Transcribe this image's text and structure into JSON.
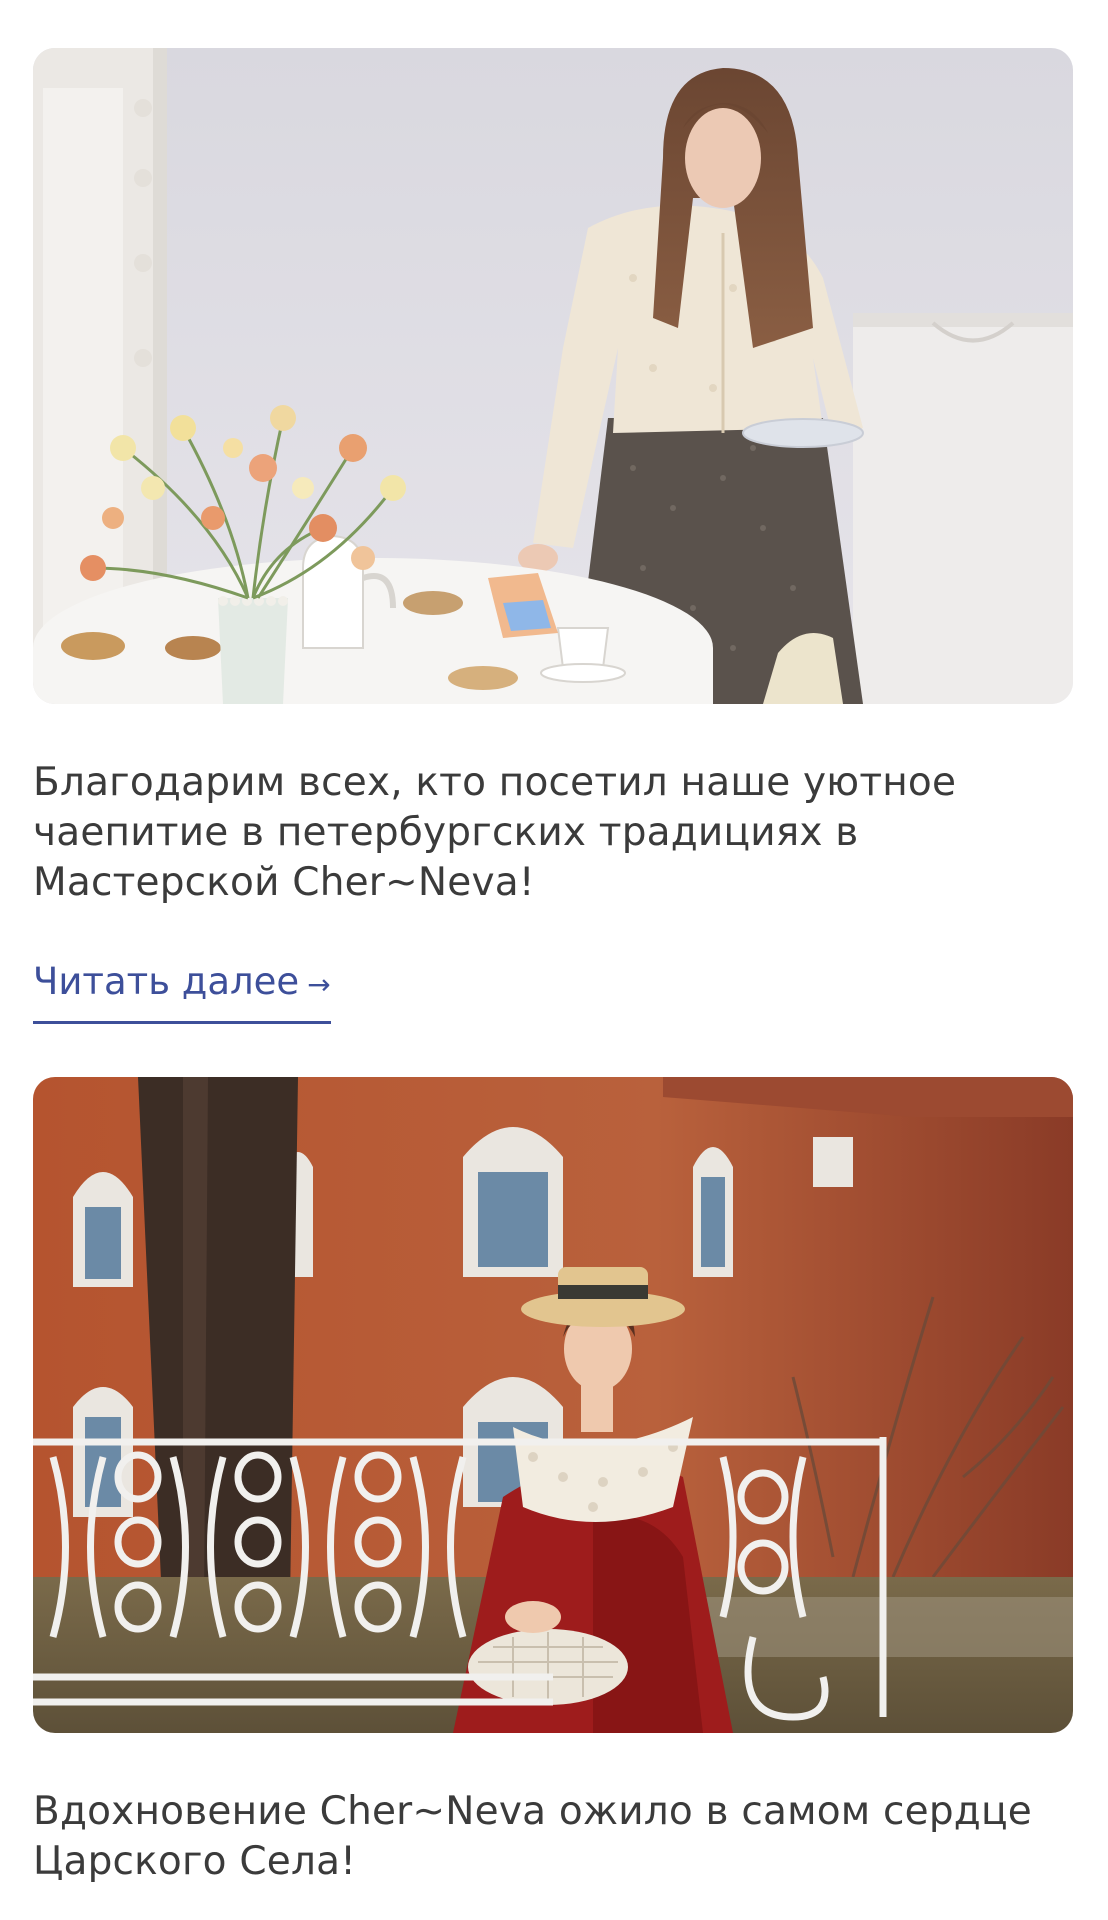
{
  "posts": [
    {
      "image_alt": "photo-tea-party",
      "title": "Благодарим всех, кто посетил наше уютное чаепитие в петербургских традициях в Мастерской Cher~Neva!",
      "read_more_label": "Читать далее",
      "read_more_arrow": "→"
    },
    {
      "image_alt": "photo-tsarskoe-selo",
      "title": "Вдохновение Cher~Neva ожило в самом сердце Царского Села!"
    }
  ],
  "colors": {
    "link": "#3d4f9a",
    "title": "#3b3b3b",
    "background": "#ffffff"
  }
}
